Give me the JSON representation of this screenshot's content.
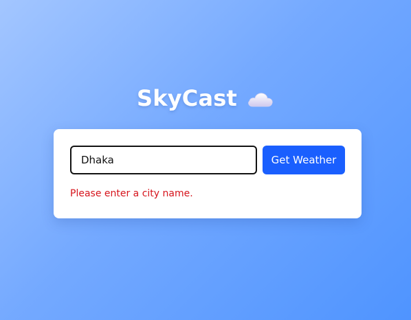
{
  "app": {
    "title": "SkyCast",
    "title_icon": "cloud-icon"
  },
  "search": {
    "input_value": "Dhaka",
    "button_label": "Get Weather"
  },
  "status": {
    "error_message": "Please enter a city name."
  },
  "colors": {
    "background_start": "#a3c6ff",
    "background_end": "#4f94ff",
    "button": "#1a5ffe",
    "error": "#d6141c"
  }
}
